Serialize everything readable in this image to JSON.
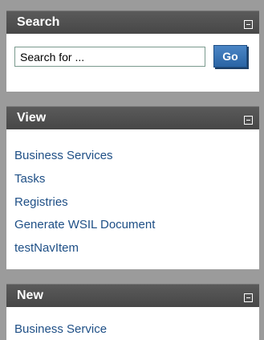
{
  "search": {
    "title": "Search",
    "input_value": "Search for ...",
    "go_label": "Go"
  },
  "view": {
    "title": "View",
    "items": [
      {
        "label": "Business Services"
      },
      {
        "label": "Tasks"
      },
      {
        "label": "Registries"
      },
      {
        "label": "Generate WSIL Document"
      },
      {
        "label": "testNavItem"
      }
    ]
  },
  "new": {
    "title": "New",
    "items": [
      {
        "label": "Business Service"
      }
    ]
  },
  "icons": {
    "collapse": "minus-box-icon"
  },
  "colors": {
    "header_bg": "#4d4d4d",
    "link": "#1e4f86",
    "button": "#3a73b4",
    "frame": "#9b9b9b"
  }
}
